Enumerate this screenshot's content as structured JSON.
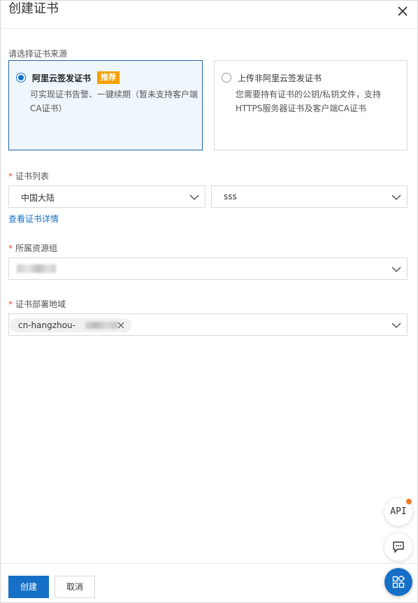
{
  "dialog": {
    "title": "创建证书"
  },
  "source": {
    "label": "请选择证书来源",
    "options": [
      {
        "title": "阿里云签发证书",
        "badge": "推荐",
        "desc": "可实现证书告警、一键续期（暂未支持客户端CA证书）",
        "selected": true
      },
      {
        "title": "上传非阿里云签发证书",
        "desc": "您需要持有证书的公钥/私钥文件，支持HTTPS服务器证书及客户端CA证书",
        "selected": false
      }
    ]
  },
  "cert_list": {
    "label": "证书列表",
    "region": "中国大陆",
    "cert": "sss",
    "detail_link": "查看证书详情"
  },
  "resource_group": {
    "label": "所属资源组"
  },
  "deploy_region": {
    "label": "证书部署地域",
    "tag": "cn-hangzhou-"
  },
  "footer": {
    "create": "创建",
    "cancel": "取消"
  },
  "float_buttons": {
    "api": "API"
  },
  "colors": {
    "primary": "#1570c6",
    "required": "#e74c3c",
    "badge": "#f5a000",
    "notify_dot": "#f47a20"
  }
}
